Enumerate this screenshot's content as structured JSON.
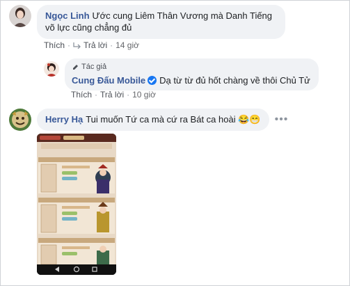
{
  "comments": [
    {
      "author": "Ngọc Linh",
      "text": "Ước cung Liêm Thân Vương mà Danh Tiếng võ lực cũng chẳng đủ",
      "actions": {
        "like": "Thích",
        "reply": "Trả lời",
        "time": "14 giờ"
      }
    },
    {
      "badge": "Tác giả",
      "author": "Cung Đấu Mobile",
      "text": "Dạ từ từ đủ hốt chàng về thôi Chủ Tử",
      "actions": {
        "like": "Thích",
        "reply": "Trả lời",
        "time": "10 giờ"
      }
    },
    {
      "author": "Herry Hạ",
      "text": "Tui muốn Tứ ca mà cứ ra Bát ca hoài",
      "emojis": [
        "😂",
        "😁"
      ],
      "more": "•••"
    }
  ],
  "colors": {
    "author_link": "#385898",
    "bubble_bg": "#f0f2f5",
    "verified": "#1877f2"
  }
}
